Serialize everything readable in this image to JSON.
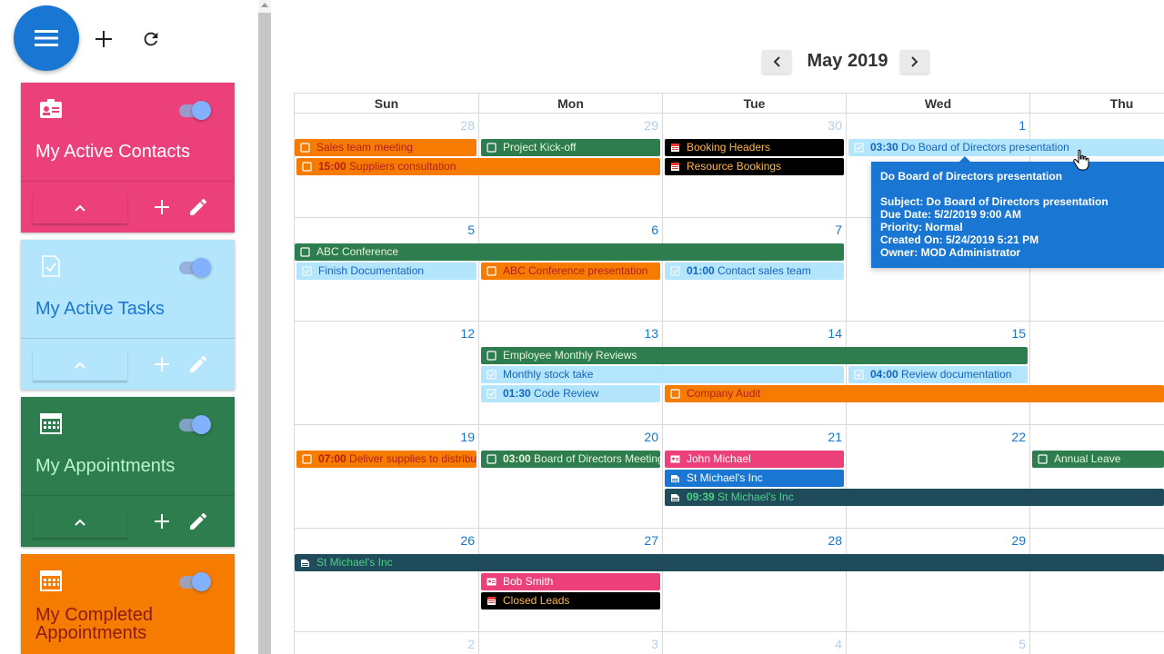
{
  "toolbar": {
    "menu_icon": "menu-icon",
    "add_icon": "plus-icon",
    "refresh_icon": "refresh-icon"
  },
  "cards": [
    {
      "title": "My Active Contacts",
      "icon": "contact-card-icon",
      "color": "#ec407a",
      "bottom_color": "#ec407a",
      "title_color": "#ffffff",
      "enabled": true
    },
    {
      "title": "My Active Tasks",
      "icon": "task-check-icon",
      "color": "#b3e5fc",
      "bottom_color": "#b3e5fc",
      "title_color": "#1976d2",
      "enabled": true
    },
    {
      "title": "My Appointments",
      "icon": "calendar-icon",
      "color": "#2e7d4f",
      "bottom_color": "#2e7d4f",
      "title_color": "#b9f6ca",
      "enabled": true
    },
    {
      "title": "My Completed Appointments",
      "title_line1": "My Completed",
      "title_line2": "Appointments",
      "icon": "calendar-icon",
      "color": "#f57c00",
      "bottom_color": "#f57c00",
      "title_color": "#8b1a1a",
      "enabled": true
    }
  ],
  "calendar": {
    "month_label": "May 2019",
    "prev_icon": "chevron-left-icon",
    "next_icon": "chevron-right-icon",
    "weekdays": [
      "Sun",
      "Mon",
      "Tue",
      "Wed",
      "Thu"
    ],
    "weeks": [
      [
        "28",
        "29",
        "30",
        "1",
        ""
      ],
      [
        "5",
        "6",
        "7",
        "",
        ""
      ],
      [
        "12",
        "13",
        "14",
        "15",
        ""
      ],
      [
        "19",
        "20",
        "21",
        "22",
        ""
      ],
      [
        "26",
        "27",
        "28",
        "29",
        ""
      ],
      [
        "2",
        "3",
        "4",
        "5",
        ""
      ]
    ],
    "events": [
      {
        "label": "Sales team meeting",
        "time": "",
        "color": "orange",
        "icon": "appointment-icon"
      },
      {
        "label": "Project Kick-off",
        "time": "",
        "color": "green",
        "icon": "appointment-icon"
      },
      {
        "label": "Booking Headers",
        "time": "",
        "color": "black",
        "icon": "calendar-icon"
      },
      {
        "label": "Do Board of Directors presentation",
        "time": "03:30",
        "color": "lightblue",
        "icon": "task-check-icon"
      },
      {
        "label": "Suppliers consultation",
        "time": "15:00",
        "color": "orange",
        "icon": "appointment-icon"
      },
      {
        "label": "Resource Bookings",
        "time": "",
        "color": "black",
        "icon": "calendar-icon"
      },
      {
        "label": "ABC Conference",
        "time": "",
        "color": "green",
        "icon": "appointment-icon"
      },
      {
        "label": "Finish Documentation",
        "time": "",
        "color": "lightblue",
        "icon": "task-check-icon"
      },
      {
        "label": "ABC Conference presentation",
        "time": "",
        "color": "orange",
        "icon": "appointment-icon"
      },
      {
        "label": "Contact sales team",
        "time": "01:00",
        "color": "lightblue",
        "icon": "task-check-icon"
      },
      {
        "label": "Employee Monthly Reviews",
        "time": "",
        "color": "green",
        "icon": "appointment-icon"
      },
      {
        "label": "Monthly stock take",
        "time": "",
        "color": "lightblue",
        "icon": "task-check-icon"
      },
      {
        "label": "Review documentation",
        "time": "04:00",
        "color": "lightblue",
        "icon": "task-check-icon"
      },
      {
        "label": "Code Review",
        "time": "01:30",
        "color": "lightblue",
        "icon": "task-check-icon"
      },
      {
        "label": "Company Audit",
        "time": "",
        "color": "orange",
        "icon": "appointment-icon"
      },
      {
        "label": "Deliver supplies to distributor",
        "time": "07:00",
        "color": "orange",
        "icon": "appointment-icon"
      },
      {
        "label": "Board of Directors Meeting",
        "time": "03:00",
        "color": "green",
        "icon": "appointment-icon"
      },
      {
        "label": "John Michael",
        "time": "",
        "color": "pink",
        "icon": "contact-card-icon"
      },
      {
        "label": "Annual Leave",
        "time": "",
        "color": "green",
        "icon": "appointment-icon"
      },
      {
        "label": "St Michael's Inc",
        "time": "",
        "color": "blue",
        "icon": "account-icon"
      },
      {
        "label": "St Michael's Inc",
        "time": "09:39",
        "color": "teal",
        "icon": "account-icon"
      },
      {
        "label": "St Michael's Inc",
        "time": "",
        "color": "teal",
        "icon": "account-icon"
      },
      {
        "label": "Bob Smith",
        "time": "",
        "color": "pink",
        "icon": "contact-card-icon"
      },
      {
        "label": "Closed Leads",
        "time": "",
        "color": "black",
        "icon": "calendar-icon"
      }
    ]
  },
  "tooltip": {
    "title": "Do Board of Directors presentation",
    "lines": [
      "Subject: Do Board of Directors presentation",
      "Due Date: 5/2/2019 9:00 AM",
      "Priority: Normal",
      "Created On: 5/24/2019 5:21 PM",
      "Owner: MOD Administrator"
    ]
  }
}
